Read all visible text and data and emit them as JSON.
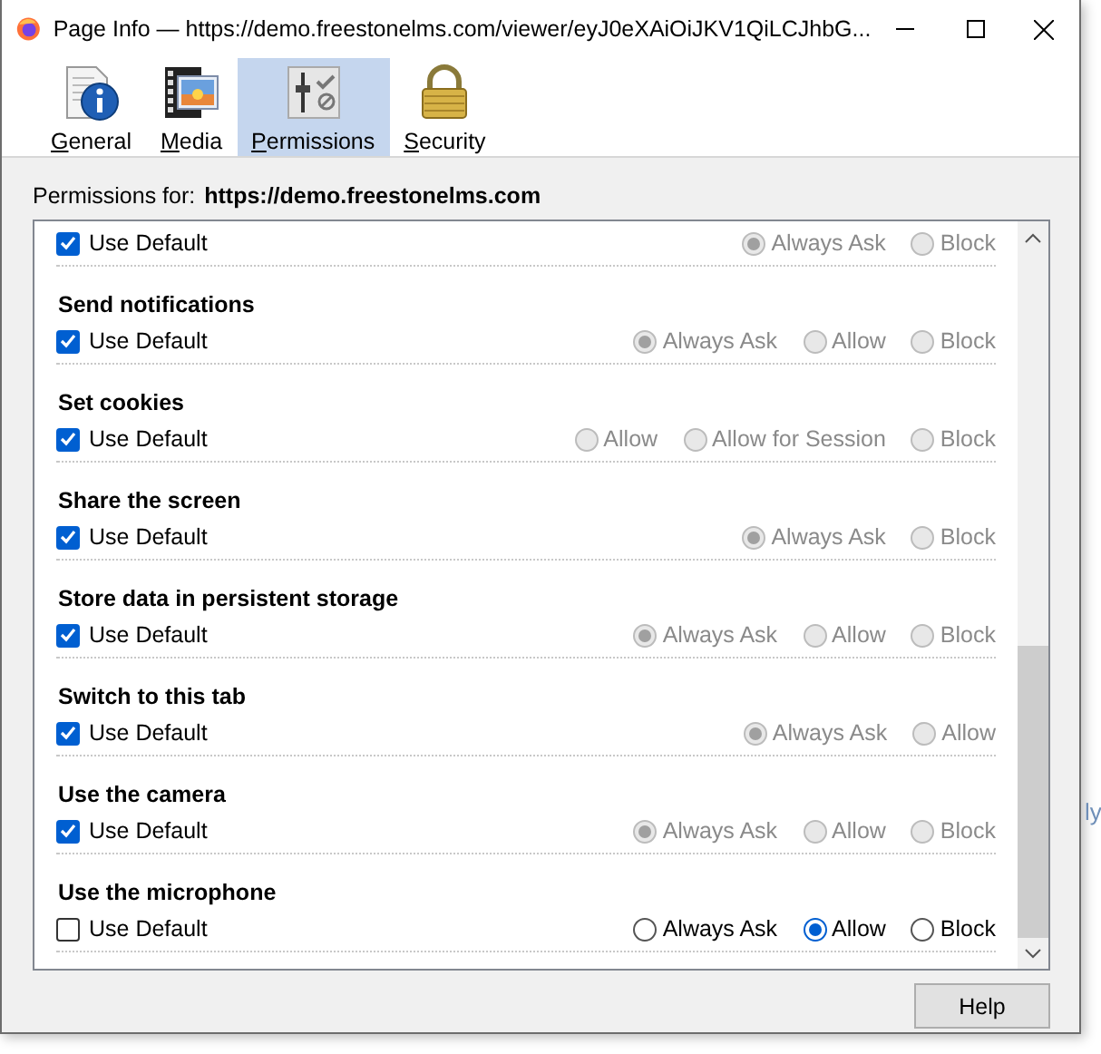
{
  "window": {
    "title": "Page Info — https://demo.freestonelms.com/viewer/eyJ0eXAiOiJKV1QiLCJhbG..."
  },
  "tabs": [
    {
      "label": "General",
      "selected": false,
      "kind": "info"
    },
    {
      "label": "Media",
      "selected": false,
      "kind": "media"
    },
    {
      "label": "Permissions",
      "selected": true,
      "kind": "permissions"
    },
    {
      "label": "Security",
      "selected": false,
      "kind": "lock"
    }
  ],
  "permissions_for": {
    "label": "Permissions for:",
    "site": "https://demo.freestonelms.com"
  },
  "permissions": [
    {
      "use_default_label": "Use Default",
      "use_default": true,
      "options": [
        {
          "label": "Always Ask",
          "selected": true
        },
        {
          "label": "Block",
          "selected": false
        }
      ]
    },
    {
      "name": "Send notifications",
      "use_default_label": "Use Default",
      "use_default": true,
      "options": [
        {
          "label": "Always Ask",
          "selected": true
        },
        {
          "label": "Allow",
          "selected": false
        },
        {
          "label": "Block",
          "selected": false
        }
      ]
    },
    {
      "name": "Set cookies",
      "use_default_label": "Use Default",
      "use_default": true,
      "options": [
        {
          "label": "Allow",
          "selected": false
        },
        {
          "label": "Allow for Session",
          "selected": false
        },
        {
          "label": "Block",
          "selected": false
        }
      ]
    },
    {
      "name": "Share the screen",
      "use_default_label": "Use Default",
      "use_default": true,
      "options": [
        {
          "label": "Always Ask",
          "selected": true
        },
        {
          "label": "Block",
          "selected": false
        }
      ]
    },
    {
      "name": "Store data in persistent storage",
      "use_default_label": "Use Default",
      "use_default": true,
      "options": [
        {
          "label": "Always Ask",
          "selected": true
        },
        {
          "label": "Allow",
          "selected": false
        },
        {
          "label": "Block",
          "selected": false
        }
      ]
    },
    {
      "name": "Switch to this tab",
      "use_default_label": "Use Default",
      "use_default": true,
      "options": [
        {
          "label": "Always Ask",
          "selected": true
        },
        {
          "label": "Allow",
          "selected": false
        }
      ]
    },
    {
      "name": "Use the camera",
      "use_default_label": "Use Default",
      "use_default": true,
      "options": [
        {
          "label": "Always Ask",
          "selected": true
        },
        {
          "label": "Allow",
          "selected": false
        },
        {
          "label": "Block",
          "selected": false
        }
      ]
    },
    {
      "name": "Use the microphone",
      "use_default_label": "Use Default",
      "use_default": false,
      "options": [
        {
          "label": "Always Ask",
          "selected": false
        },
        {
          "label": "Allow",
          "selected": true
        },
        {
          "label": "Block",
          "selected": false
        }
      ]
    }
  ],
  "buttons": [
    "Help"
  ],
  "background_text": "ly"
}
